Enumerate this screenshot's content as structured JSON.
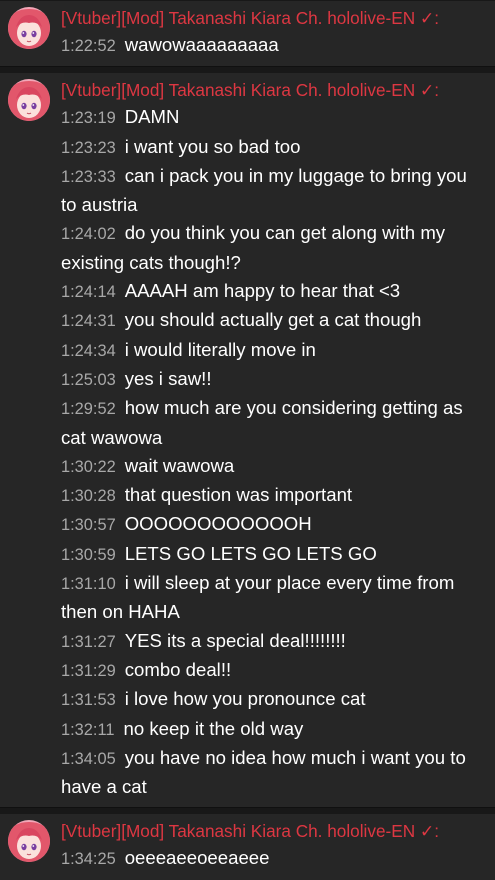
{
  "author_name": "[Vtuber][Mod] Takanashi Kiara Ch. hololive-EN ✓:",
  "groups": [
    {
      "messages": [
        {
          "time": "1:22:52",
          "text": "wawowaaaaaaaaa"
        }
      ]
    },
    {
      "messages": [
        {
          "time": "1:23:19",
          "text": "DAMN"
        },
        {
          "time": "1:23:23",
          "text": "i want you so bad too"
        },
        {
          "time": "1:23:33",
          "text": "can i pack you in my luggage to bring you to austria"
        },
        {
          "time": "1:24:02",
          "text": "do you think you can get along with my existing cats though!?"
        },
        {
          "time": "1:24:14",
          "text": "AAAAH am happy to hear that <3"
        },
        {
          "time": "1:24:31",
          "text": "you should actually get a cat though"
        },
        {
          "time": "1:24:34",
          "text": "i would literally move in"
        },
        {
          "time": "1:25:03",
          "text": "yes i saw!!"
        },
        {
          "time": "1:29:52",
          "text": "how much are you considering getting as cat wawowa"
        },
        {
          "time": "1:30:22",
          "text": "wait wawowa"
        },
        {
          "time": "1:30:28",
          "text": "that question was important"
        },
        {
          "time": "1:30:57",
          "text": "OOOOOOOOOOOOH"
        },
        {
          "time": "1:30:59",
          "text": "LETS GO LETS GO LETS GO"
        },
        {
          "time": "1:31:10",
          "text": "i will sleep at your place every time from then on HAHA"
        },
        {
          "time": "1:31:27",
          "text": "YES its a special deal!!!!!!!!"
        },
        {
          "time": "1:31:29",
          "text": "combo deal!!"
        },
        {
          "time": "1:31:53",
          "text": "i love how you pronounce cat"
        },
        {
          "time": "1:32:11",
          "text": "no keep it the old way"
        },
        {
          "time": "1:34:05",
          "text": "you have no idea how much i want you to have a cat"
        }
      ]
    },
    {
      "messages": [
        {
          "time": "1:34:25",
          "text": "oeeeaeeoeeaeee"
        }
      ]
    }
  ],
  "colors": {
    "author": "#dd3742",
    "timestamp": "#a8a8a8",
    "message": "#ffffff",
    "group_bg": "#262626",
    "page_bg": "#181818"
  }
}
